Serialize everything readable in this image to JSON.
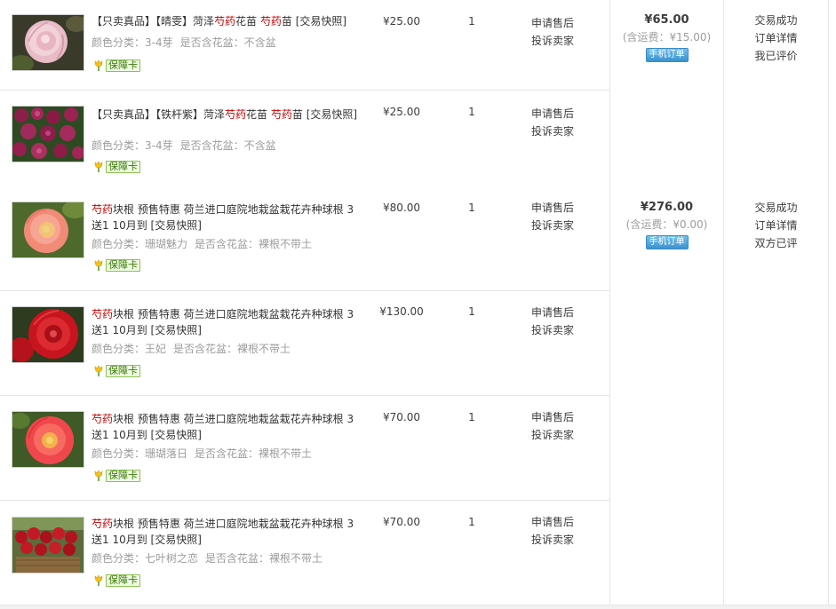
{
  "common": {
    "guarantee_label": "保障卡",
    "after_sale": "申请售后",
    "complain": "投诉卖家",
    "mobile_order": "手机订单",
    "order_detail": "订单详情"
  },
  "orders": [
    {
      "total": "¥65.00",
      "shipping": "(含运费：¥15.00)",
      "status": "交易成功",
      "review": "我已评价",
      "items": [
        {
          "title_pre": "【只卖真品】【晴雯】菏泽",
          "title_kw1": "芍药",
          "title_mid": "花苗 ",
          "title_kw2": "芍药",
          "title_post": "苗 [交易快照]",
          "sku_color": "颜色分类：3-4芽",
          "sku_pot": "是否含花盆：不含盆",
          "price": "¥25.00",
          "qty": "1"
        },
        {
          "title_pre": "【只卖真品】【铁杆紫】菏泽",
          "title_kw1": "芍药",
          "title_mid": "花苗 ",
          "title_kw2": "芍药",
          "title_post": "苗 [交易快照]",
          "sku_color": "颜色分类：3-4芽",
          "sku_pot": "是否含花盆：不含盆",
          "price": "¥25.00",
          "qty": "1"
        }
      ]
    },
    {
      "total": "¥276.00",
      "shipping": "(含运费：¥0.00)",
      "status": "交易成功",
      "review": "双方已评",
      "items": [
        {
          "title_kw1": "芍药",
          "title_post": "块根 预售特惠 荷兰进口庭院地栽盆栽花卉种球根 3送1 10月到 [交易快照]",
          "sku_color": "颜色分类：珊瑚魅力",
          "sku_pot": "是否含花盆：裸根不带土",
          "price": "¥80.00",
          "qty": "1"
        },
        {
          "title_kw1": "芍药",
          "title_post": "块根 预售特惠 荷兰进口庭院地栽盆栽花卉种球根 3送1 10月到 [交易快照]",
          "sku_color": "颜色分类：王妃",
          "sku_pot": "是否含花盆：裸根不带土",
          "price": "¥130.00",
          "qty": "1"
        },
        {
          "title_kw1": "芍药",
          "title_post": "块根 预售特惠 荷兰进口庭院地栽盆栽花卉种球根 3送1 10月到 [交易快照]",
          "sku_color": "颜色分类：珊瑚落日",
          "sku_pot": "是否含花盆：裸根不带土",
          "price": "¥70.00",
          "qty": "1"
        },
        {
          "title_kw1": "芍药",
          "title_post": "块根 预售特惠 荷兰进口庭院地栽盆栽花卉种球根 3送1 10月到 [交易快照]",
          "sku_color": "颜色分类：七叶树之恋",
          "sku_pot": "是否含花盆：裸根不带土",
          "price": "¥70.00",
          "qty": "1"
        }
      ]
    }
  ],
  "icons": {
    "guarantee": "tulip-guarantee-icon",
    "thumbs": [
      "pink-peony-photo",
      "purple-peony-field-photo",
      "coral-peony-photo",
      "red-peony-photo",
      "coral-sunset-peony-photo",
      "red-peony-basket-photo"
    ]
  },
  "colors": {
    "keyword": "#c40000",
    "muted": "#9c9c9c",
    "border": "#e6e6e6",
    "guarantee_green": "#8cc252",
    "mobile_blue": "#3c92cf"
  }
}
